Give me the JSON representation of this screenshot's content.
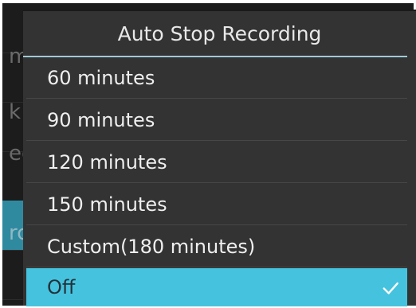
{
  "dialog": {
    "title": "Auto Stop Recording",
    "options": [
      {
        "label": "60 minutes",
        "selected": false
      },
      {
        "label": "90 minutes",
        "selected": false
      },
      {
        "label": "120 minutes",
        "selected": false
      },
      {
        "label": "150 minutes",
        "selected": false
      },
      {
        "label": "Custom(180 minutes)",
        "selected": false
      },
      {
        "label": "Off",
        "selected": true
      }
    ],
    "selected_check_icon": "checkmark-icon"
  },
  "underlay": {
    "peek_items": [
      "m",
      "k",
      "ec",
      "rc"
    ]
  },
  "colors": {
    "dialog_bg": "#333333",
    "accent": "#45c3de",
    "header_line": "#9fc9d6",
    "underlay_bg": "#1c1c1c",
    "underlay_highlight": "#2f8aa0"
  }
}
